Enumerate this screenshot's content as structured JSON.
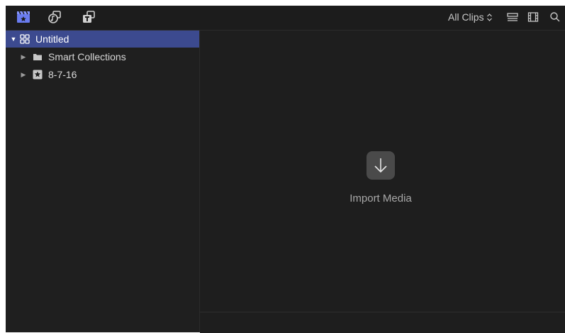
{
  "toolbar": {
    "icons": [
      "libraries-icon",
      "photos-and-audio-icon",
      "titles-and-generators-icon"
    ],
    "clips_filter": "All Clips",
    "filter_chevron": "⌃⌄",
    "right_icons": [
      "list-view-icon",
      "filmstrip-view-icon",
      "search-icon"
    ]
  },
  "sidebar": {
    "items": [
      {
        "label": "Untitled",
        "icon": "library-grid-icon",
        "expanded": true,
        "selected": true
      },
      {
        "label": "Smart Collections",
        "icon": "folder-icon",
        "expanded": false,
        "selected": false
      },
      {
        "label": "8-7-16",
        "icon": "star-event-icon",
        "expanded": false,
        "selected": false
      }
    ]
  },
  "browser": {
    "import_icon": "down-arrow-icon",
    "import_label": "Import Media"
  },
  "colors": {
    "selection": "#3c4a8f",
    "library_icon": "#6a7cf0"
  }
}
